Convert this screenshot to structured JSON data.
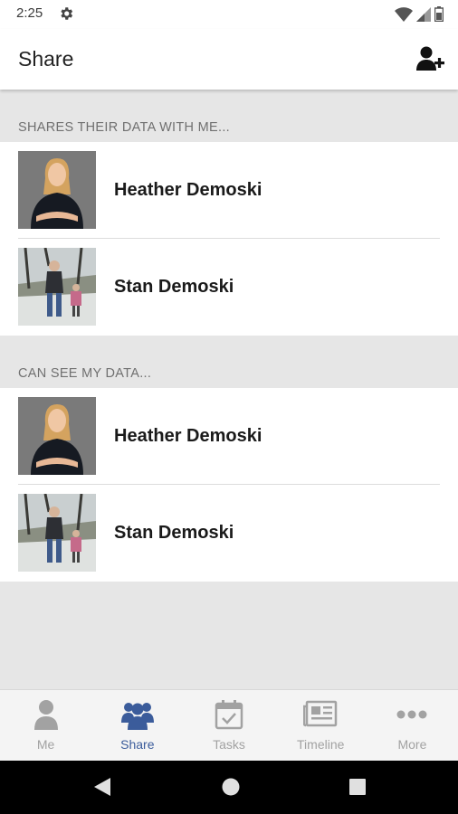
{
  "status": {
    "time": "2:25"
  },
  "appbar": {
    "title": "Share"
  },
  "sections": [
    {
      "header": "SHARES THEIR DATA WITH ME...",
      "people": [
        {
          "name": "Heather Demoski"
        },
        {
          "name": "Stan Demoski"
        }
      ]
    },
    {
      "header": "CAN SEE MY DATA...",
      "people": [
        {
          "name": "Heather Demoski"
        },
        {
          "name": "Stan Demoski"
        }
      ]
    }
  ],
  "nav": {
    "items": [
      {
        "label": "Me",
        "icon": "person-icon"
      },
      {
        "label": "Share",
        "icon": "group-icon"
      },
      {
        "label": "Tasks",
        "icon": "calendar-check-icon"
      },
      {
        "label": "Timeline",
        "icon": "newspaper-icon"
      },
      {
        "label": "More",
        "icon": "more-dots-icon"
      }
    ],
    "active": "Share"
  },
  "colors": {
    "accent": "#3b5c9b",
    "inactive": "#a2a2a2",
    "background": "#e6e6e6"
  }
}
